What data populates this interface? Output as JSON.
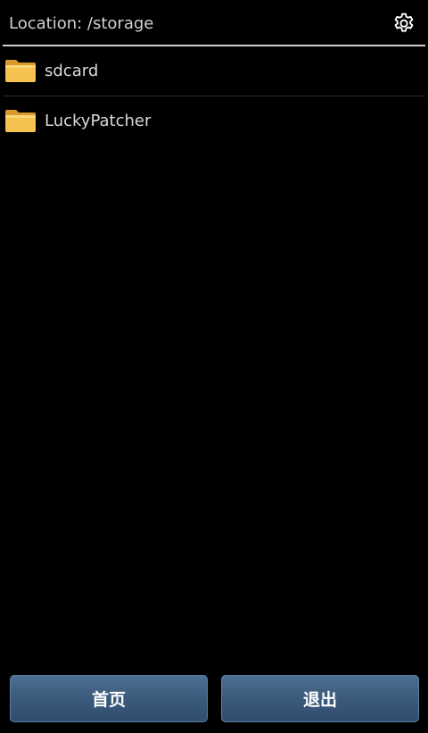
{
  "location": {
    "label": "Location: /storage",
    "settings_icon": "gear-icon"
  },
  "files": [
    {
      "name": "sdcard",
      "icon": "folder-icon"
    },
    {
      "name": "LuckyPatcher",
      "icon": "folder-icon"
    }
  ],
  "bottom_bar": {
    "home_label": "首页",
    "exit_label": "退出"
  },
  "colors": {
    "background": "#000000",
    "button": "#3b5a7c",
    "folder": "#f3b84a"
  }
}
